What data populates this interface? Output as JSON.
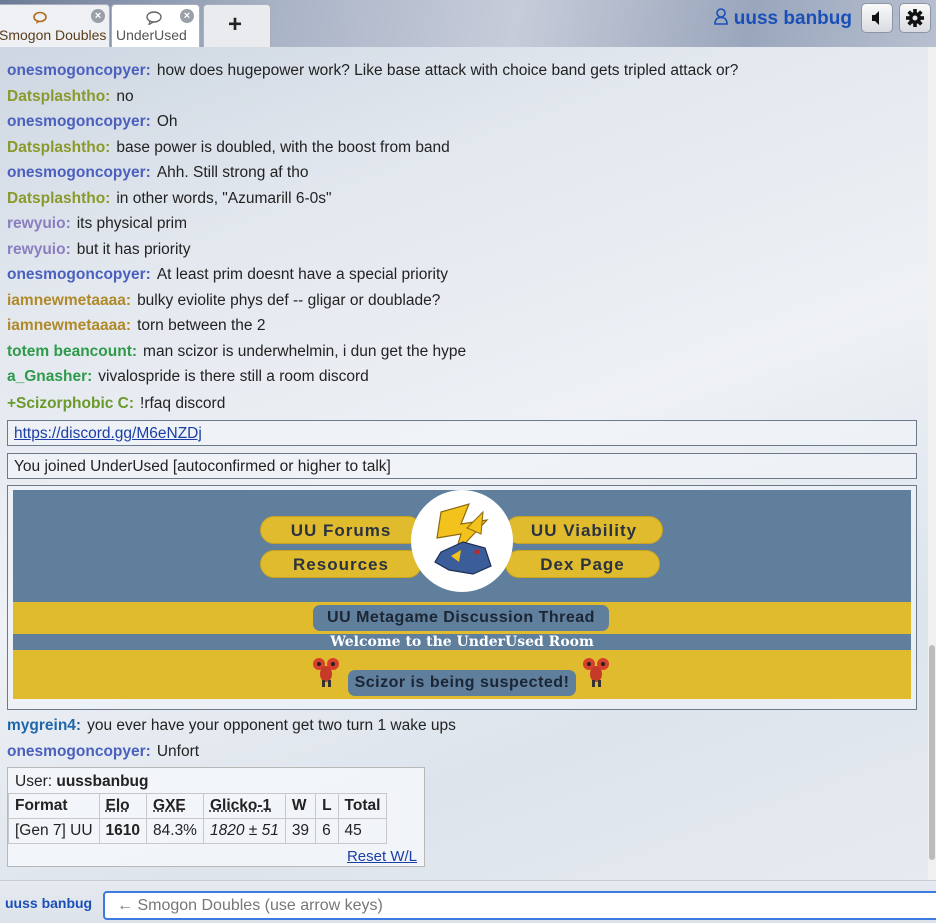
{
  "header": {
    "tabs": [
      {
        "label": "Smogon Doubles"
      },
      {
        "label": "UnderUsed"
      }
    ],
    "add_tab_label": "+",
    "username": "uuss banbug"
  },
  "messages": [
    {
      "user": "onesmogoncopyer:",
      "text": "how does hugepower work? Like base attack with choice band gets tripled attack or?",
      "color": "#4a5fbe"
    },
    {
      "user": "Datsplashtho:",
      "text": "no",
      "color": "#8a9a2a"
    },
    {
      "user": "onesmogoncopyer:",
      "text": "Oh",
      "color": "#4a5fbe"
    },
    {
      "user": "Datsplashtho:",
      "text": "base power is doubled, with the boost from band",
      "color": "#8a9a2a"
    },
    {
      "user": "onesmogoncopyer:",
      "text": "Ahh. Still strong af tho",
      "color": "#4a5fbe"
    },
    {
      "user": "Datsplashtho:",
      "text": "in other words, \"Azumarill 6-0s\"",
      "color": "#8a9a2a"
    },
    {
      "user": "rewyuio:",
      "text": "its physical prim",
      "color": "#8a7ec0"
    },
    {
      "user": "rewyuio:",
      "text": "but it has priority",
      "color": "#8a7ec0"
    },
    {
      "user": "onesmogoncopyer:",
      "text": "At least prim doesnt have a special priority",
      "color": "#4a5fbe"
    },
    {
      "user": "iamnewmetaaaa:",
      "text": "bulky eviolite phys def -- gligar or doublade?",
      "color": "#b08a2a"
    },
    {
      "user": "iamnewmetaaaa:",
      "text": "torn between the 2",
      "color": "#b08a2a"
    },
    {
      "user": "totem beancount:",
      "text": "man scizor is underwhelmin, i dun get the hype",
      "color": "#2e9a4a"
    },
    {
      "user": "a_Gnasher:",
      "text": "vivalospride is there still a room discord",
      "color": "#2e9a4a"
    },
    {
      "user": "+Scizorphobic C:",
      "text": "!rfaq discord",
      "color": "#6a9a2a"
    }
  ],
  "discord_link": "https://discord.gg/M6eNZDj",
  "join_notice": "You joined UnderUsed [autoconfirmed or higher to talk]",
  "banner": {
    "uu_forums": "UU Forums",
    "uu_viability": "UU Viability",
    "resources": "Resources",
    "dex_page": "Dex Page",
    "discussion_thread": "UU Metagame Discussion Thread",
    "welcome": "Welcome to the UnderUsed Room",
    "suspect": "Scizor is being suspected!"
  },
  "messages_after": [
    {
      "user": "mygrein4:",
      "text": "you ever have your opponent get two turn 1 wake ups",
      "color": "#1f66a8"
    },
    {
      "user": "onesmogoncopyer:",
      "text": "Unfort",
      "color": "#4a5fbe"
    }
  ],
  "rank": {
    "user_label": "User:",
    "user_name": "uussbanbug",
    "headers": [
      "Format",
      "Elo",
      "GXE",
      "Glicko-1",
      "W",
      "L",
      "Total"
    ],
    "row": {
      "format": "[Gen 7] UU",
      "elo": "1610",
      "gxe": "84.3%",
      "glicko": "1820 ± 51",
      "w": "39",
      "l": "6",
      "total": "45"
    },
    "reset_label": "Reset W/L"
  },
  "footer": {
    "username": "uuss banbug",
    "input_placeholder": "← Smogon Doubles (use arrow keys)"
  }
}
